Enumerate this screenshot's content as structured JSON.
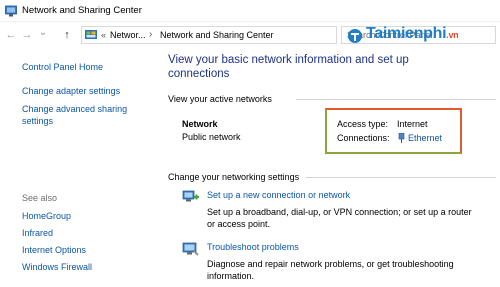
{
  "window": {
    "title": "Network and Sharing Center"
  },
  "nav": {
    "back_glyph": "←",
    "forward_glyph": "→",
    "dropdown_glyph": "⌄",
    "up_glyph": "↑",
    "breadcrumb_prefix": "«",
    "breadcrumb_1": "Networ...",
    "breadcrumb_sep": "›",
    "breadcrumb_2": "Network and Sharing Center",
    "search_placeholder": "Search Control Panel",
    "watermark_brand": "Taimienphi",
    "watermark_tld": ".vn"
  },
  "left_pane": {
    "links": [
      "Control Panel Home",
      "Change adapter settings",
      "Change advanced sharing",
      "settings"
    ],
    "see_also_label": "See also",
    "see_also_links": [
      "HomeGroup",
      "Infrared",
      "Internet Options",
      "Windows Firewall"
    ]
  },
  "main": {
    "title_line1": "View your basic network information and set up",
    "title_line2": "connections",
    "active_networks_heading": "View your active networks",
    "network_name": "Network",
    "network_type": "Public network",
    "access_type_label": "Access type:",
    "access_type_value": "Internet",
    "connections_label": "Connections:",
    "connections_value": "Ethernet",
    "change_settings_heading": "Change your networking settings",
    "tasks": [
      {
        "title": "Set up a new connection or network",
        "desc_line1": "Set up a broadband, dial-up, or VPN connection; or set up a router",
        "desc_line2": "or access point.",
        "icon": "new-connection-icon"
      },
      {
        "title": "Troubleshoot problems",
        "desc_line1": "Diagnose and repair network problems, or get troubleshooting",
        "desc_line2": "information.",
        "icon": "troubleshoot-icon"
      }
    ]
  },
  "colors": {
    "link": "#0b57a8",
    "title_blue": "#1e3287",
    "highlight_box_top": "#e05a2a",
    "highlight_box_bottom": "#8aa63c"
  }
}
